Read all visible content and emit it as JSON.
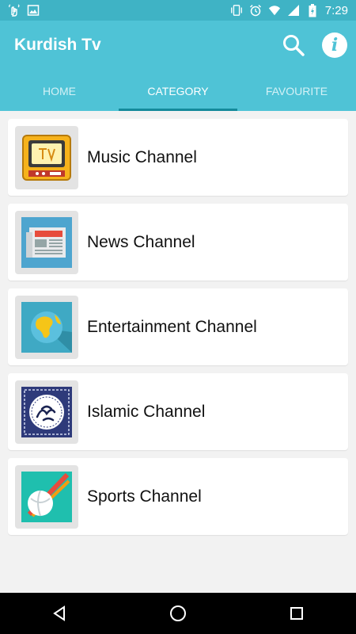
{
  "status_bar": {
    "time": "7:29",
    "left_icons": [
      "vibration-hand-icon",
      "image-icon"
    ],
    "right_icons": [
      "vibrate-icon",
      "alarm-icon",
      "wifi-icon",
      "signal-icon",
      "battery-icon"
    ]
  },
  "app_bar": {
    "title": "Kurdish Tv",
    "actions": [
      "search-icon",
      "info-icon"
    ],
    "color": "#4fc3d6"
  },
  "tabs": [
    {
      "label": "HOME",
      "active": false
    },
    {
      "label": "CATEGORY",
      "active": true
    },
    {
      "label": "FAVOURITE",
      "active": false
    }
  ],
  "categories": [
    {
      "label": "Music Channel",
      "icon": "tv-icon"
    },
    {
      "label": "News Channel",
      "icon": "newspaper-icon"
    },
    {
      "label": "Entertainment Channel",
      "icon": "globe-icon"
    },
    {
      "label": "Islamic Channel",
      "icon": "calligraphy-emblem-icon"
    },
    {
      "label": "Sports Channel",
      "icon": "sports-ball-icon"
    }
  ],
  "nav_bar": [
    "back-icon",
    "home-icon",
    "recents-icon"
  ]
}
